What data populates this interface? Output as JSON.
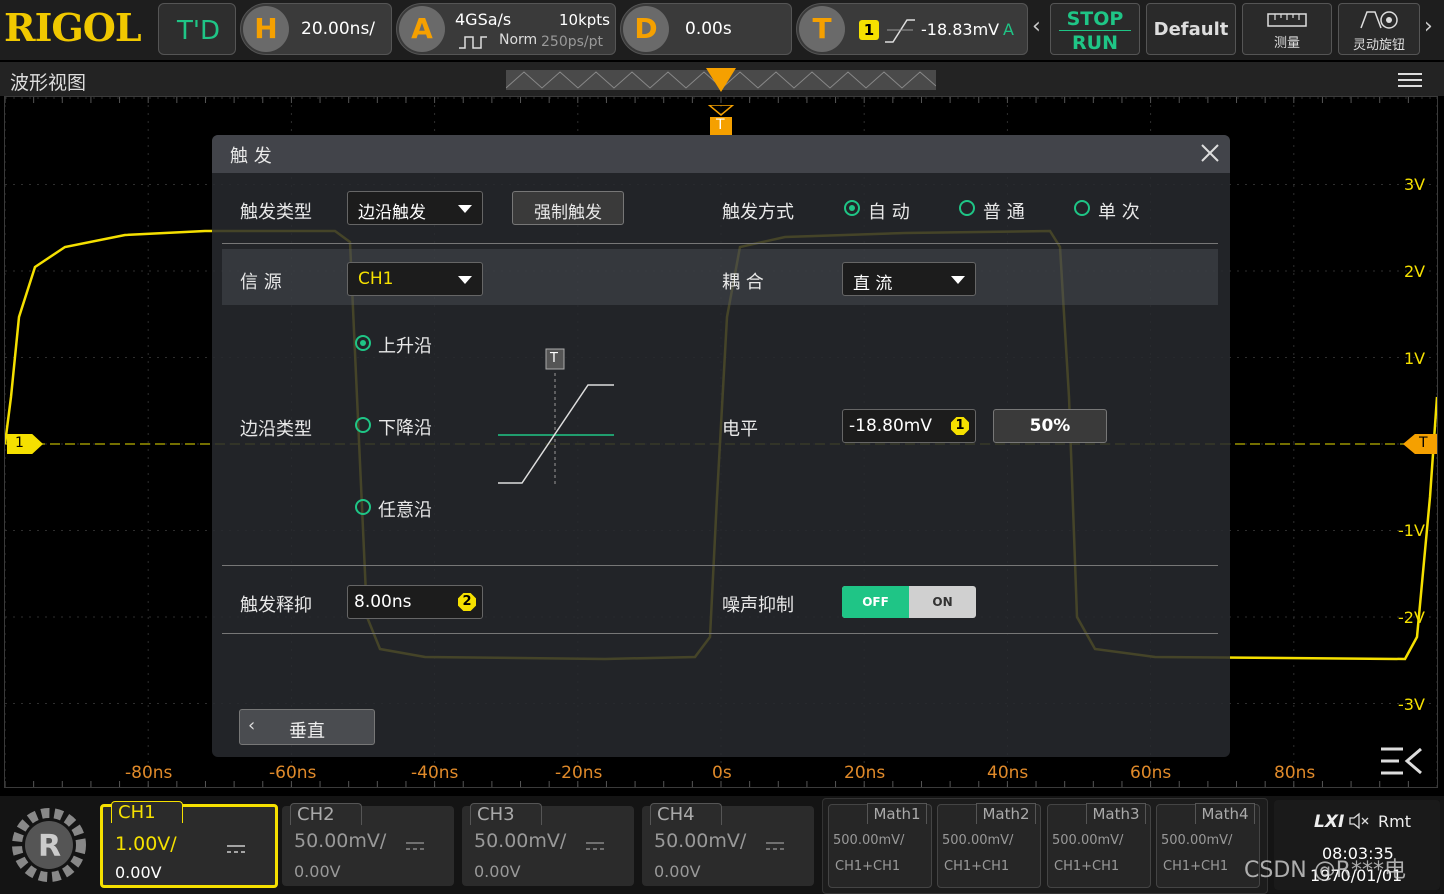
{
  "brand": "RIGOL",
  "topbar": {
    "mode": "T'D",
    "horizontal": {
      "letter": "H",
      "timebase": "20.00ns/"
    },
    "acquire": {
      "letter": "A",
      "sample_rate": "4GSa/s",
      "memory": "10kpts",
      "mode": "Norm",
      "resolution": "250ps/pt"
    },
    "delay": {
      "letter": "D",
      "value": "0.00s"
    },
    "trigger": {
      "letter": "T",
      "source_badge": "1",
      "level": "-18.83mV",
      "mode_letter": "A"
    },
    "stop_label": "STOP",
    "run_label": "RUN",
    "default_label": "Default",
    "measure_label": "测量",
    "knob_label": "灵动旋钮"
  },
  "waveview": {
    "title": "波形视图"
  },
  "markers": {
    "trigger_top": "T",
    "trigger_right": "T",
    "ch1": "1"
  },
  "x_ticks": [
    "-80ns",
    "-60ns",
    "-40ns",
    "-20ns",
    "0s",
    "20ns",
    "40ns",
    "60ns",
    "80ns"
  ],
  "y_ticks": [
    "3V",
    "2V",
    "1V",
    "-1V",
    "-2V",
    "-3V"
  ],
  "dialog": {
    "title": "触 发",
    "trigger_type_label": "触发类型",
    "trigger_type_value": "边沿触发",
    "force_label": "强制触发",
    "sweep_label": "触发方式",
    "sweep_options": [
      "自 动",
      "普 通",
      "单 次"
    ],
    "sweep_selected": 0,
    "source_label": "信 源",
    "source_value": "CH1",
    "coupling_label": "耦 合",
    "coupling_value": "直 流",
    "slope_label": "边沿类型",
    "slope_options": [
      "上升沿",
      "下降沿",
      "任意沿"
    ],
    "slope_selected": 0,
    "slope_graphic_marker": "T",
    "level_label": "电平",
    "level_value": "-18.80mV",
    "level_badge": "1",
    "fifty_label": "50%",
    "holdoff_label": "触发释抑",
    "holdoff_value": "8.00ns",
    "holdoff_badge": "2",
    "noise_label": "噪声抑制",
    "noise_off": "OFF",
    "noise_on": "ON",
    "back_label": "垂直"
  },
  "channels": [
    {
      "name": "CH1",
      "scale": "1.00V/",
      "offset": "0.00V",
      "active": true
    },
    {
      "name": "CH2",
      "scale": "50.00mV/",
      "offset": "0.00V",
      "active": false
    },
    {
      "name": "CH3",
      "scale": "50.00mV/",
      "offset": "0.00V",
      "active": false
    },
    {
      "name": "CH4",
      "scale": "50.00mV/",
      "offset": "0.00V",
      "active": false
    }
  ],
  "maths": [
    {
      "name": "Math1",
      "scale": "500.00mV/",
      "expr": "CH1+CH1"
    },
    {
      "name": "Math2",
      "scale": "500.00mV/",
      "expr": "CH1+CH1"
    },
    {
      "name": "Math3",
      "scale": "500.00mV/",
      "expr": "CH1+CH1"
    },
    {
      "name": "Math4",
      "scale": "500.00mV/",
      "expr": "CH1+CH1"
    }
  ],
  "status": {
    "lxi": "LXI",
    "rmt": "Rmt",
    "time": "08:03:35",
    "date": "1970/01/01",
    "watermark": "CSDN @R***电"
  },
  "colors": {
    "ch1": "#f5e000",
    "accent": "#f5a000",
    "green": "#1fc586"
  }
}
